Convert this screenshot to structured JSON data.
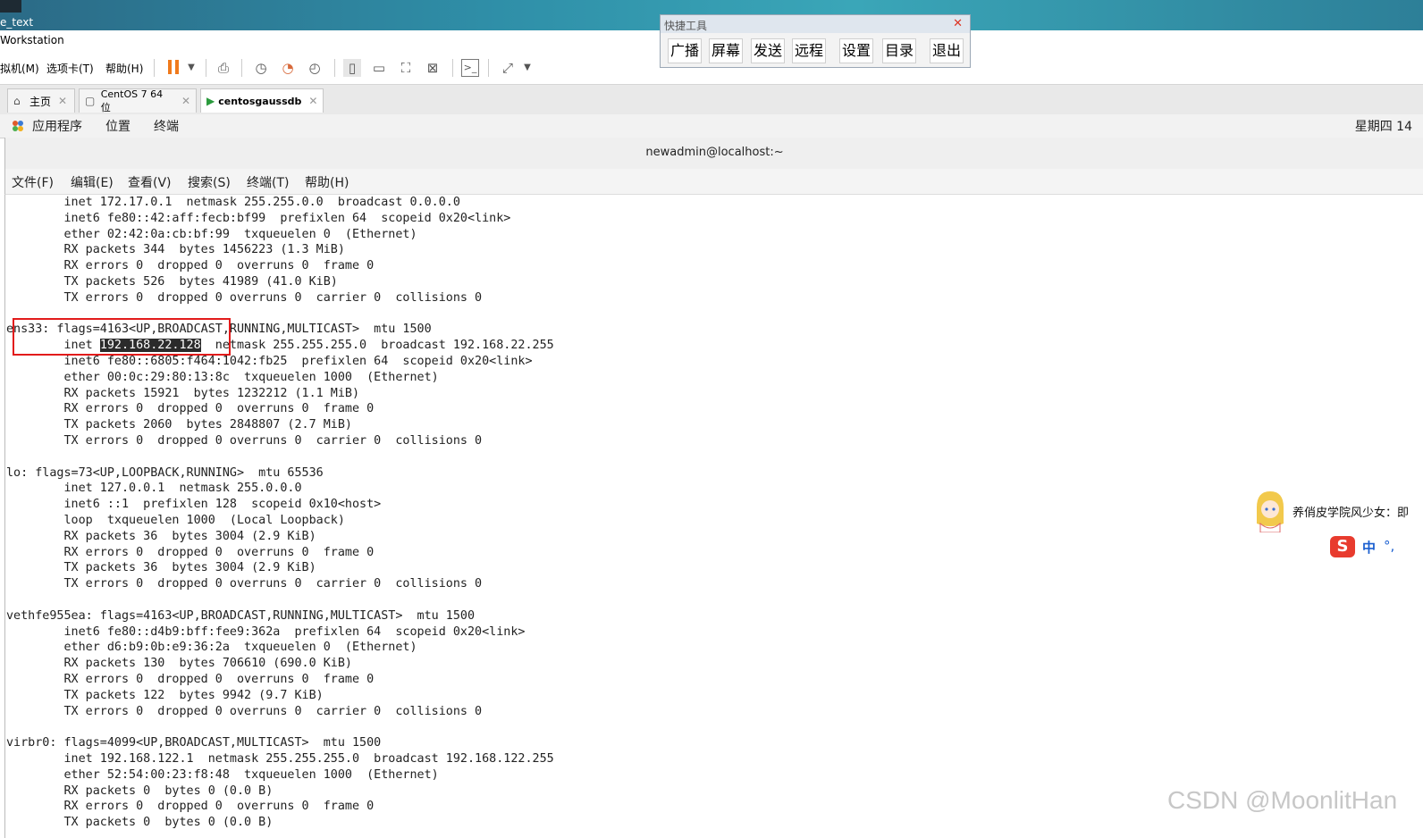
{
  "window": {
    "top_label": "e_text",
    "app_title": "Workstation"
  },
  "menu": {
    "items": [
      "拟机(M)",
      "选项卡(T)",
      "帮助(H)"
    ]
  },
  "tabs": [
    {
      "label": "主页",
      "icon": "home-icon"
    },
    {
      "label": "CentOS 7 64 位",
      "icon": "vm-icon"
    },
    {
      "label": "centosgaussdb",
      "icon": "vm-running-icon",
      "active": true
    }
  ],
  "gnome": {
    "apps": "应用程序",
    "places": "位置",
    "terminal": "终端",
    "clock": "星期四 14"
  },
  "terminal": {
    "title": "newadmin@localhost:~",
    "menu": [
      "文件(F)",
      "编辑(E)",
      "查看(V)",
      "搜索(S)",
      "终端(T)",
      "帮助(H)"
    ],
    "lines": [
      "        inet 172.17.0.1  netmask 255.255.0.0  broadcast 0.0.0.0",
      "        inet6 fe80::42:aff:fecb:bf99  prefixlen 64  scopeid 0x20<link>",
      "        ether 02:42:0a:cb:bf:99  txqueuelen 0  (Ethernet)",
      "        RX packets 344  bytes 1456223 (1.3 MiB)",
      "        RX errors 0  dropped 0  overruns 0  frame 0",
      "        TX packets 526  bytes 41989 (41.0 KiB)",
      "        TX errors 0  dropped 0 overruns 0  carrier 0  collisions 0",
      "",
      "ens33: flags=4163<UP,BROADCAST,RUNNING,MULTICAST>  mtu 1500",
      "        inet 192.168.22.128  netmask 255.255.255.0  broadcast 192.168.22.255",
      "        inet6 fe80::6805:f464:1042:fb25  prefixlen 64  scopeid 0x20<link>",
      "        ether 00:0c:29:80:13:8c  txqueuelen 1000  (Ethernet)",
      "        RX packets 15921  bytes 1232212 (1.1 MiB)",
      "        RX errors 0  dropped 0  overruns 0  frame 0",
      "        TX packets 2060  bytes 2848807 (2.7 MiB)",
      "        TX errors 0  dropped 0 overruns 0  carrier 0  collisions 0",
      "",
      "lo: flags=73<UP,LOOPBACK,RUNNING>  mtu 65536",
      "        inet 127.0.0.1  netmask 255.0.0.0",
      "        inet6 ::1  prefixlen 128  scopeid 0x10<host>",
      "        loop  txqueuelen 1000  (Local Loopback)",
      "        RX packets 36  bytes 3004 (2.9 KiB)",
      "        RX errors 0  dropped 0  overruns 0  frame 0",
      "        TX packets 36  bytes 3004 (2.9 KiB)",
      "        TX errors 0  dropped 0 overruns 0  carrier 0  collisions 0",
      "",
      "vethfe955ea: flags=4163<UP,BROADCAST,RUNNING,MULTICAST>  mtu 1500",
      "        inet6 fe80::d4b9:bff:fee9:362a  prefixlen 64  scopeid 0x20<link>",
      "        ether d6:b9:0b:e9:36:2a  txqueuelen 0  (Ethernet)",
      "        RX packets 130  bytes 706610 (690.0 KiB)",
      "        RX errors 0  dropped 0  overruns 0  frame 0",
      "        TX packets 122  bytes 9942 (9.7 KiB)",
      "        TX errors 0  dropped 0 overruns 0  carrier 0  collisions 0",
      "",
      "virbr0: flags=4099<UP,BROADCAST,MULTICAST>  mtu 1500",
      "        inet 192.168.122.1  netmask 255.255.255.0  broadcast 192.168.122.255",
      "        ether 52:54:00:23:f8:48  txqueuelen 1000  (Ethernet)",
      "        RX packets 0  bytes 0 (0.0 B)",
      "        RX errors 0  dropped 0  overruns 0  frame 0",
      "        TX packets 0  bytes 0 (0.0 B)"
    ],
    "highlight": {
      "line_index": 9,
      "text": "192.168.22.128",
      "prefix": "        inet "
    }
  },
  "quick_tools": {
    "title": "快捷工具",
    "buttons": [
      "广播",
      "屏幕",
      "发送",
      "远程",
      "设置",
      "目录",
      "退出"
    ]
  },
  "ime": {
    "ticker": "养俏皮学院风少女：即",
    "mode": "中",
    "punct": "°,"
  },
  "watermark": "CSDN @MoonlitHan",
  "colors": {
    "annotation_box": "#e21b1b",
    "pause": "#f07a1c"
  }
}
